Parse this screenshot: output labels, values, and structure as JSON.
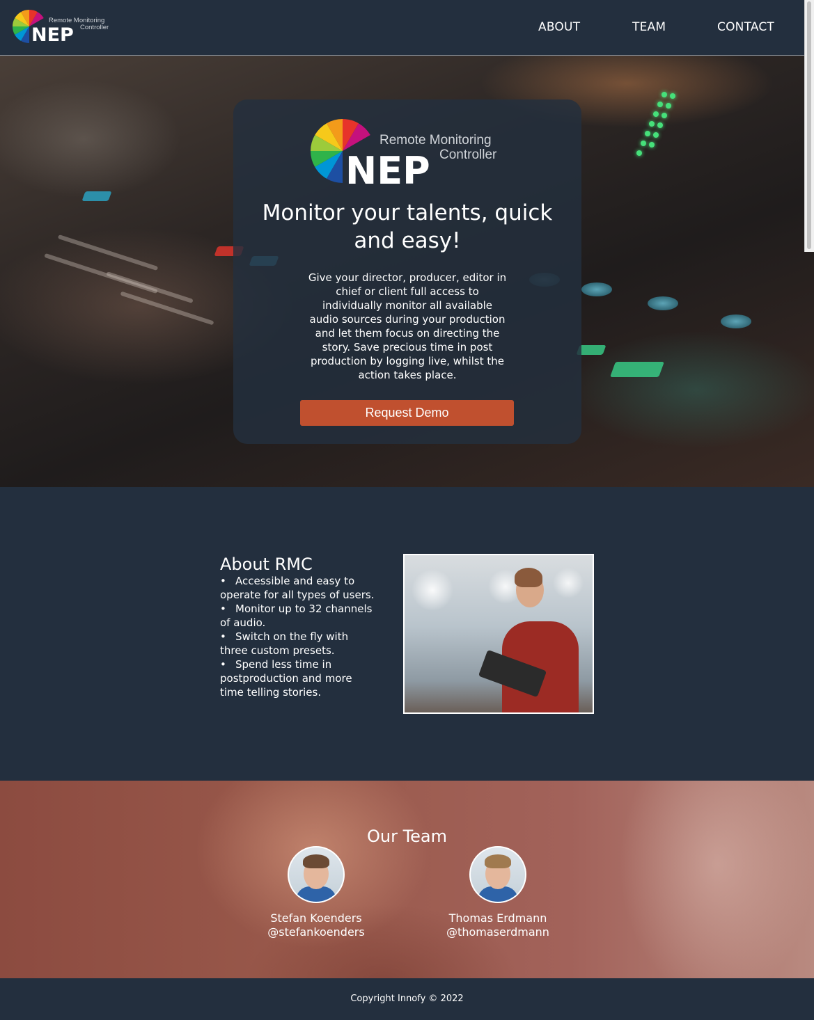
{
  "header": {
    "logo": {
      "line1": "Remote Monitoring",
      "line2": "Controller",
      "wordmark": "NEP"
    },
    "nav": [
      {
        "label": "ABOUT"
      },
      {
        "label": "TEAM"
      },
      {
        "label": "CONTACT"
      }
    ]
  },
  "hero": {
    "logo": {
      "line1": "Remote Monitoring",
      "line2": "Controller",
      "wordmark": "NEP"
    },
    "title": "Monitor your talents, quick and easy!",
    "description": "Give your director, producer, editor in chief or client full access to individually monitor all available audio sources during your production and let them focus on directing the story. Save precious time in post production by logging live, whilst the action takes place.",
    "button_label": "Request Demo"
  },
  "about": {
    "title": "About RMC",
    "bullets": [
      "Accessible and easy to operate for all types of users.",
      "Monitor up to 32 channels of audio.",
      "Switch on the fly with three custom presets.",
      "Spend less time in postproduction and more time telling stories."
    ]
  },
  "team": {
    "title": "Our Team",
    "members": [
      {
        "name": "Stefan Koenders",
        "handle": "@stefankoenders"
      },
      {
        "name": "Thomas Erdmann",
        "handle": "@thomaserdmann"
      }
    ]
  },
  "footer": {
    "copyright": "Copyright Innofy © 2022"
  },
  "colors": {
    "navy": "#232f3e",
    "accent_button": "#c0502f",
    "logo_wheel": [
      "#e7332a",
      "#c5117d",
      "#6b2c8f",
      "#1d4fa3",
      "#0096d6",
      "#2fb34a",
      "#9ccb3b",
      "#f6c91a",
      "#f39b1a"
    ]
  }
}
